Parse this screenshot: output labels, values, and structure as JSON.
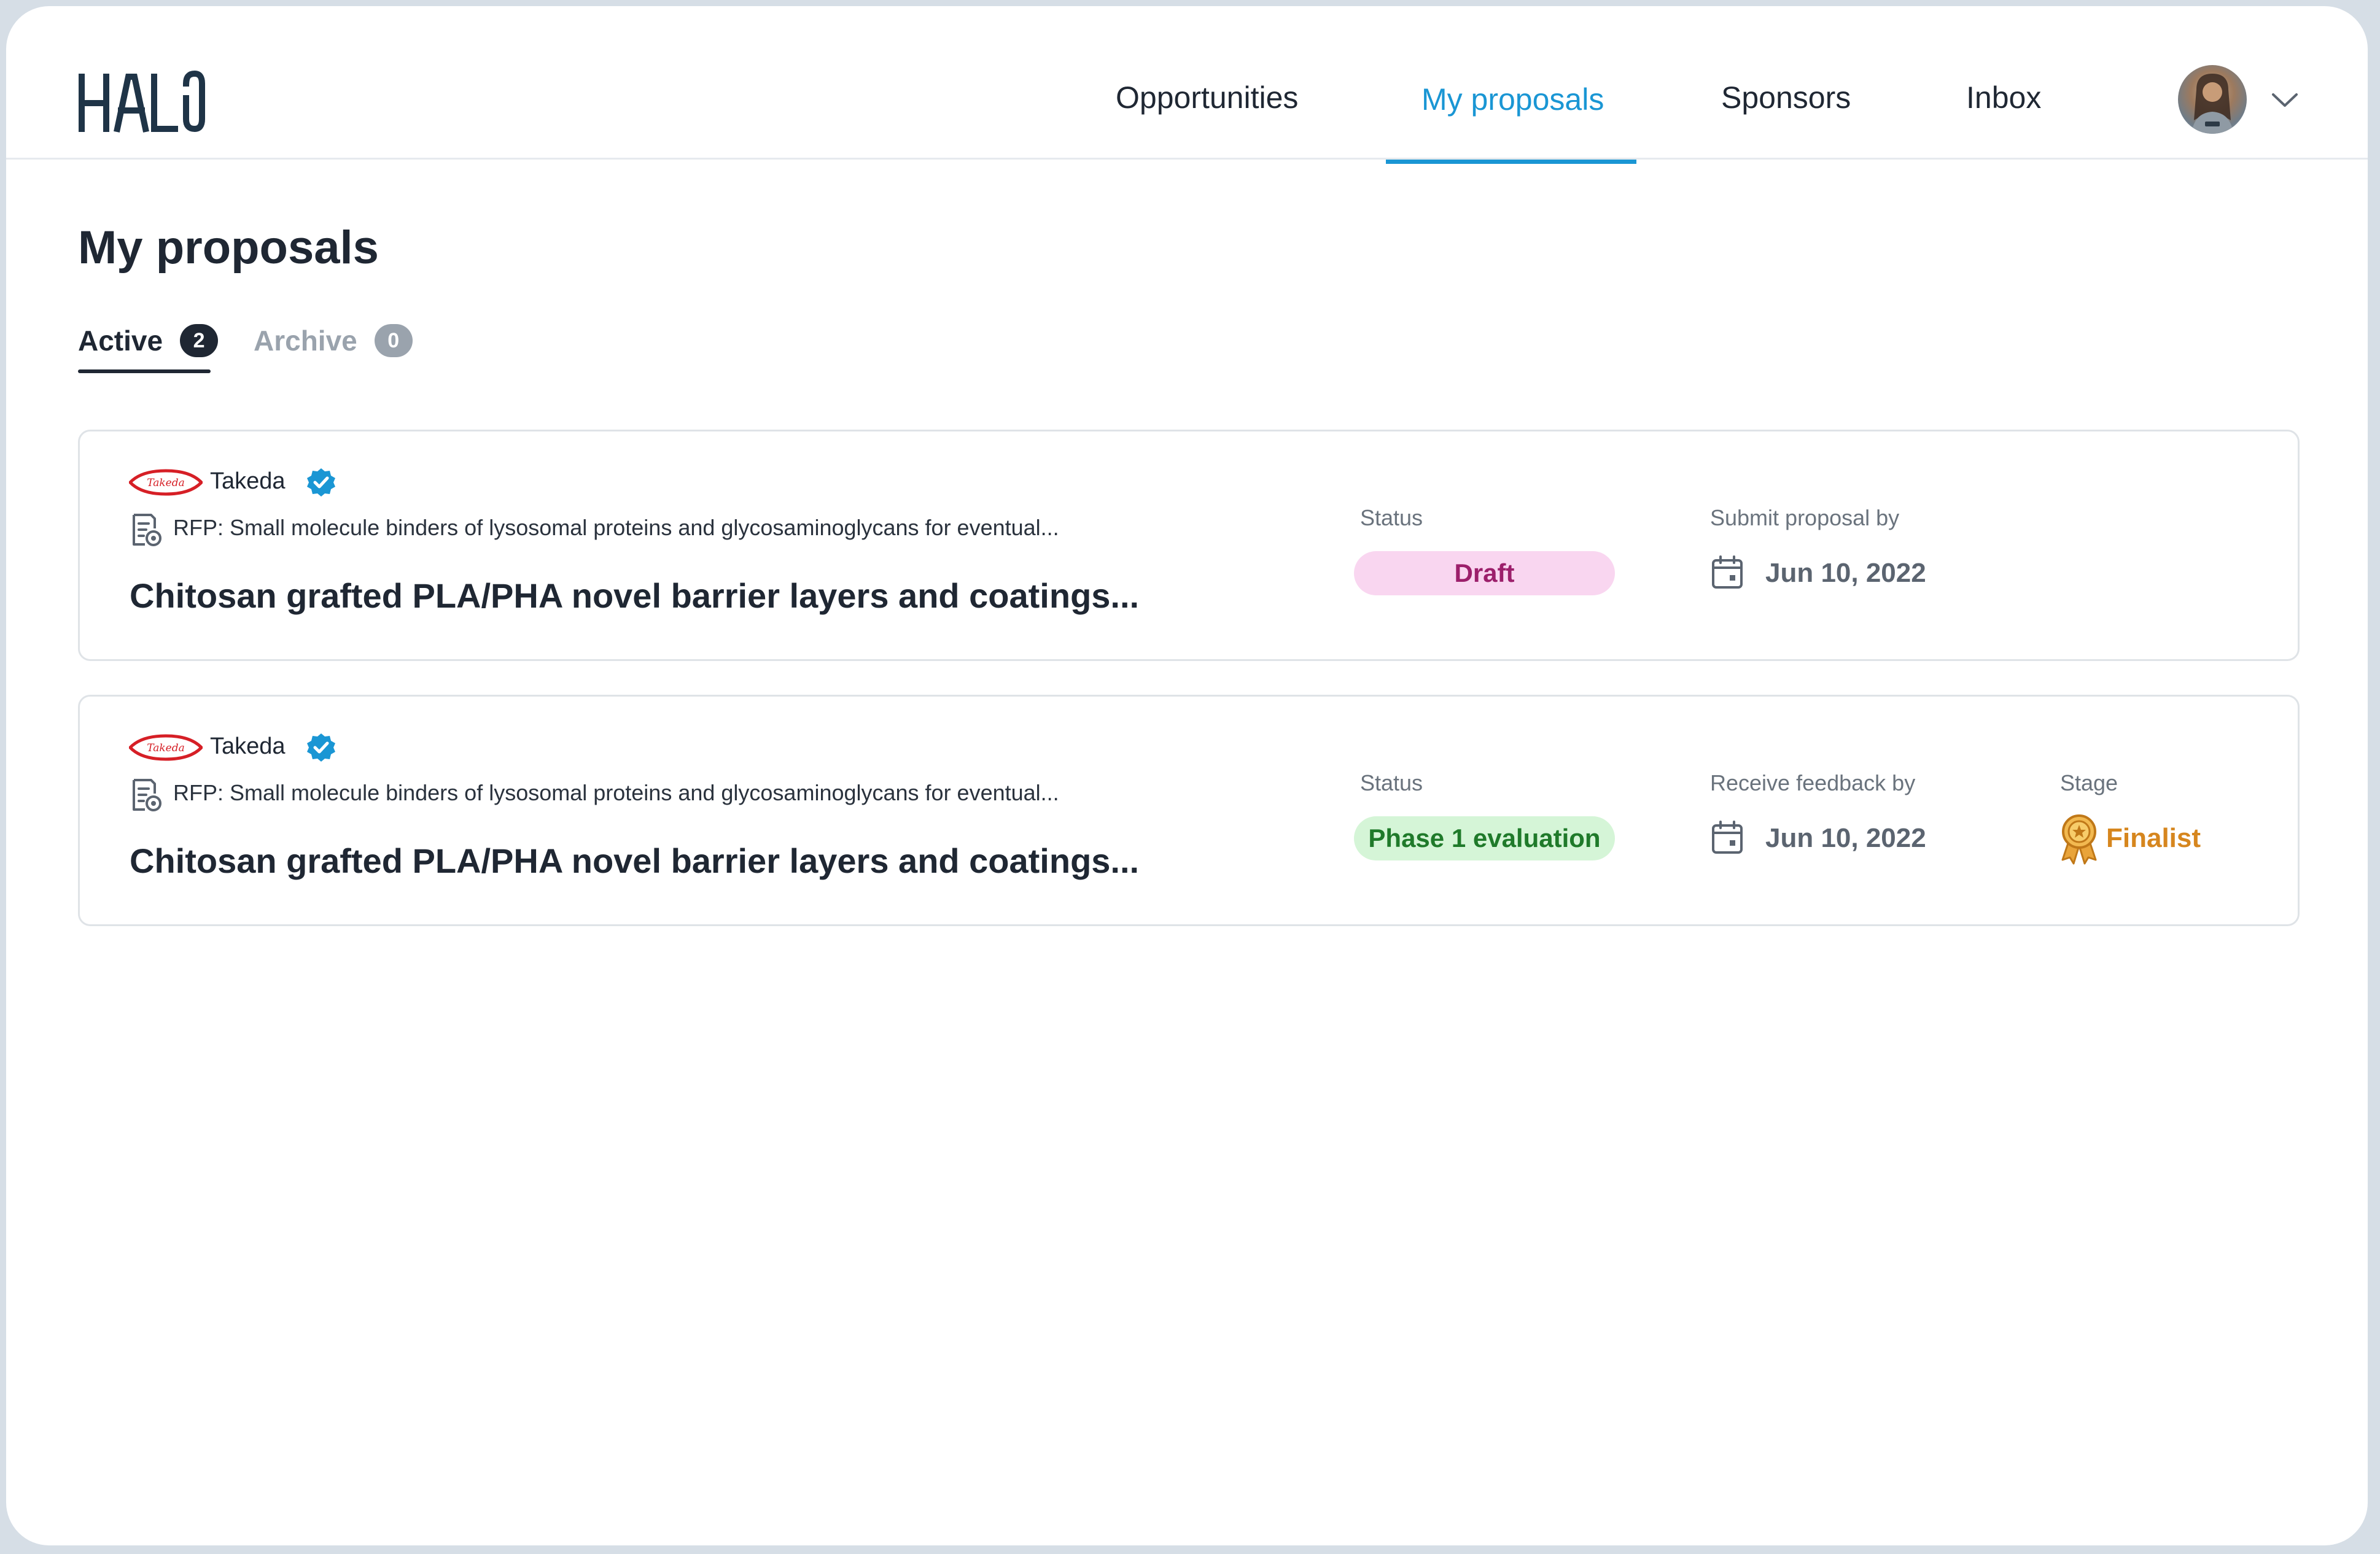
{
  "app": {
    "logo_text": "HALO"
  },
  "nav": {
    "items": [
      {
        "label": "Opportunities"
      },
      {
        "label": "My proposals"
      },
      {
        "label": "Sponsors"
      },
      {
        "label": "Inbox"
      }
    ],
    "active": "My proposals"
  },
  "page": {
    "title": "My proposals"
  },
  "tabs": [
    {
      "label": "Active",
      "count": "2"
    },
    {
      "label": "Archive",
      "count": "0"
    }
  ],
  "proposals": [
    {
      "sponsor": "Takeda",
      "sponsor_logo_text": "Takeda",
      "rfp": "RFP: Small molecule binders of lysosomal proteins and glycosaminoglycans for eventual...",
      "title": "Chitosan grafted PLA/PHA novel barrier layers and coatings...",
      "status_label": "Status",
      "status": "Draft",
      "date_label": "Submit proposal by",
      "date": "Jun 10, 2022"
    },
    {
      "sponsor": "Takeda",
      "sponsor_logo_text": "Takeda",
      "rfp": "RFP: Small molecule binders of lysosomal proteins and glycosaminoglycans for eventual...",
      "title": "Chitosan grafted PLA/PHA novel barrier layers and coatings...",
      "status_label": "Status",
      "status": "Phase 1 evaluation",
      "date_label": "Receive feedback by",
      "date": "Jun 10, 2022",
      "stage_label": "Stage",
      "stage": "Finalist"
    }
  ],
  "colors": {
    "accent": "#1a96d4",
    "text": "#1f2733",
    "draft_bg": "#f9d6f0",
    "draft_text": "#9c1f6b",
    "phase_bg": "#d5f5d7",
    "phase_text": "#1f7a2a",
    "finalist": "#d6861e"
  }
}
